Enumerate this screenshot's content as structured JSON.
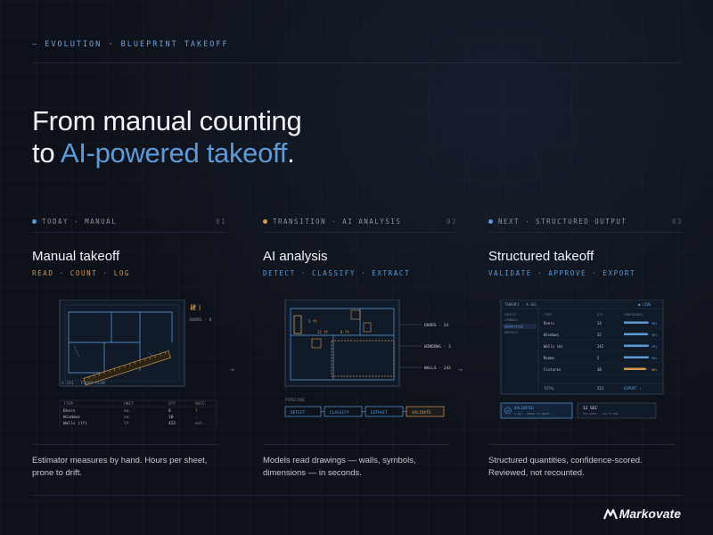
{
  "eyebrow": "— EVOLUTION · BLUEPRINT TAKEOFF",
  "headline": {
    "line1": "From manual counting",
    "line2_prefix": "to ",
    "line2_accent": "AI-powered takeoff",
    "line2_suffix": "."
  },
  "colors": {
    "blue": "#5b9bd8",
    "orange": "#d39a4e",
    "bg": "#0d1119"
  },
  "columns": [
    {
      "tag": "TODAY · MANUAL",
      "num": "01",
      "dot_color": "#5b9bd8",
      "title": "Manual takeoff",
      "subtitle": "READ · COUNT · LOG",
      "subtitle_color": "#d39a4e",
      "desc_line1": "Estimator measures by hand. Hours per sheet,",
      "desc_line2": "prone to drift.",
      "viz": {
        "tally": "𝍸𝍷",
        "tally_label": "DOORS · 8",
        "plan_label": "A-101 · FLOOR PLAN",
        "table_headers": [
          "ITEM",
          "UNIT",
          "QTY",
          "NOTE"
        ],
        "rows": [
          [
            "Doors",
            "ea.",
            "8",
            "?"
          ],
          [
            "Windows",
            "ea.",
            "18",
            "-"
          ],
          [
            "Walls (lf)",
            "lf",
            "422",
            "est."
          ]
        ]
      }
    },
    {
      "tag": "TRANSITION · AI ANALYSIS",
      "num": "02",
      "dot_color": "#d39a4e",
      "title": "AI analysis",
      "subtitle": "DETECT · CLASSIFY · EXTRACT",
      "subtitle_color": "#5b9bd8",
      "desc_line1": "Models read drawings — walls, symbols,",
      "desc_line2": "dimensions — in seconds.",
      "viz": {
        "callouts": [
          "DOORS · 14",
          "WINDOWS · 2",
          "WALLS · 142"
        ],
        "pipeline_label": "PIPELINE",
        "pipeline": [
          "DETECT",
          "CLASSIFY",
          "EXTRACT",
          "VALIDATE"
        ],
        "dims": [
          "3 ft",
          "12 ft",
          "8 ft"
        ]
      }
    },
    {
      "tag": "NEXT · STRUCTURED OUTPUT",
      "num": "03",
      "dot_color": "#5b9bd8",
      "title": "Structured takeoff",
      "subtitle": "VALIDATE · APPROVE · EXPORT",
      "subtitle_color": "#5b9bd8",
      "desc_line1": "Structured quantities, confidence-scored.",
      "desc_line2": "Reviewed, not recounted.",
      "viz": {
        "panel_title": "TAKEOFF · A-101",
        "live": "● LIVE",
        "side_items": [
          "SHEETS",
          "SYMBOLS",
          "QUANTITIES",
          "REPORTS"
        ],
        "headers": [
          "ITEM",
          "QTY",
          "CONFIDENCE"
        ],
        "rows": [
          {
            "item": "Doors",
            "qty": "14",
            "conf": 0.98,
            "pct": "98%"
          },
          {
            "item": "Windows",
            "qty": "22",
            "conf": 0.96,
            "pct": "96%"
          },
          {
            "item": "Walls (m)",
            "qty": "142",
            "conf": 0.99,
            "pct": "99%"
          },
          {
            "item": "Rooms",
            "qty": "5",
            "conf": 0.99,
            "pct": "99%"
          },
          {
            "item": "Fixtures",
            "qty": "38",
            "conf": 0.88,
            "pct": "88%"
          }
        ],
        "total_label": "TOTAL",
        "total_value": "221",
        "export": "EXPORT ↗",
        "validate_title": "VALIDATED",
        "validate_sub": "A-101 · READY TO QUOTE",
        "time_title": "12 SEC",
        "time_sub": "PER SHEET · AVG TO END"
      }
    }
  ],
  "arrows": [
    "→",
    "→"
  ],
  "logo": "Markovate"
}
